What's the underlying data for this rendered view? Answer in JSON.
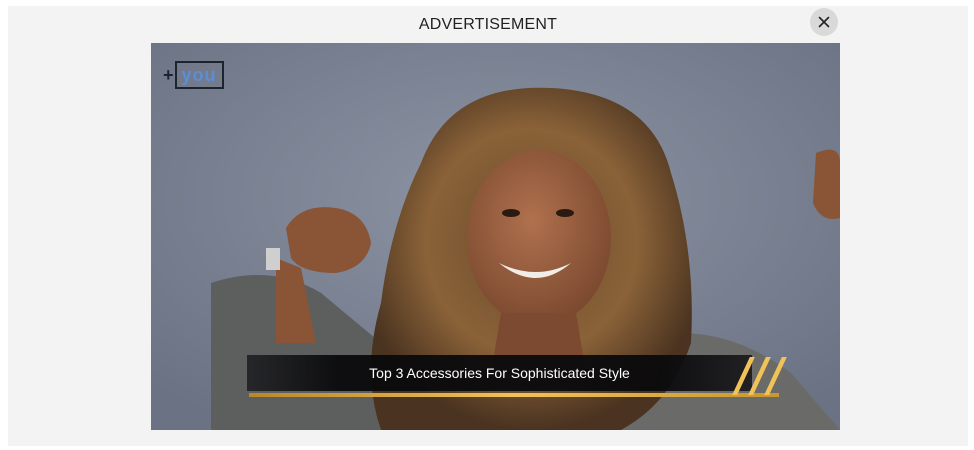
{
  "ad": {
    "label": "ADVERTISEMENT",
    "close_icon": "close-icon",
    "close_glyph": "×"
  },
  "video": {
    "brand": {
      "plus": "+",
      "name": "you"
    },
    "caption": "Top 3 Accessories For Sophisticated Style"
  },
  "colors": {
    "panel_background": "#f3f3f3",
    "video_backdrop": "#7d8596",
    "caption_accent": "#f1c257"
  }
}
